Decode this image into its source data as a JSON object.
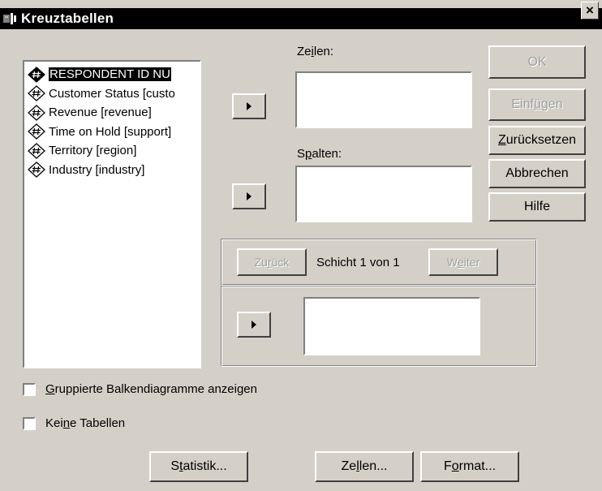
{
  "window": {
    "title": "Kreuztabellen",
    "close_glyph": "×",
    "title_icon": "spss-crosstabs-icon"
  },
  "variables": [
    {
      "label": "RESPONDENT ID NU",
      "icon": "numeric-variable-icon",
      "selected": true
    },
    {
      "label": "Customer Status [custo",
      "icon": "numeric-variable-icon",
      "selected": false
    },
    {
      "label": "Revenue [revenue]",
      "icon": "numeric-variable-icon",
      "selected": false
    },
    {
      "label": "Time on Hold [support]",
      "icon": "numeric-variable-icon",
      "selected": false
    },
    {
      "label": "Territory [region]",
      "icon": "numeric-variable-icon",
      "selected": false
    },
    {
      "label": "Industry [industry]",
      "icon": "numeric-variable-icon",
      "selected": false
    }
  ],
  "rows": {
    "label_pre": "Ze",
    "label_u": "i",
    "label_post": "len:"
  },
  "columns": {
    "label_pre": "S",
    "label_u": "p",
    "label_post": "alten:"
  },
  "layer": {
    "back_pre": "Zu",
    "back_u": "r",
    "back_post": "ück",
    "status": "Schicht 1 von 1",
    "next_pre": "W",
    "next_u": "e",
    "next_post": "iter"
  },
  "buttons": {
    "ok": "OK",
    "paste_pre": "Einf",
    "paste_u": "ü",
    "paste_post": "gen",
    "reset_pre": "",
    "reset_u": "Z",
    "reset_post": "urücksetzen",
    "cancel": "Abbrechen",
    "help": "Hilfe"
  },
  "options": {
    "clustered_pre": "",
    "clustered_u": "G",
    "clustered_post": "ruppierte Balkendiagramme anzeigen",
    "clustered_checked": false,
    "suppress_pre": "Kei",
    "suppress_u": "n",
    "suppress_post": "e Tabellen",
    "suppress_checked": false
  },
  "bottom_buttons": {
    "stats_pre": "S",
    "stats_u": "t",
    "stats_post": "atistik...",
    "cells_pre": "Ze",
    "cells_u": "l",
    "cells_post": "len...",
    "format_pre": "F",
    "format_u": "o",
    "format_post": "rmat..."
  }
}
